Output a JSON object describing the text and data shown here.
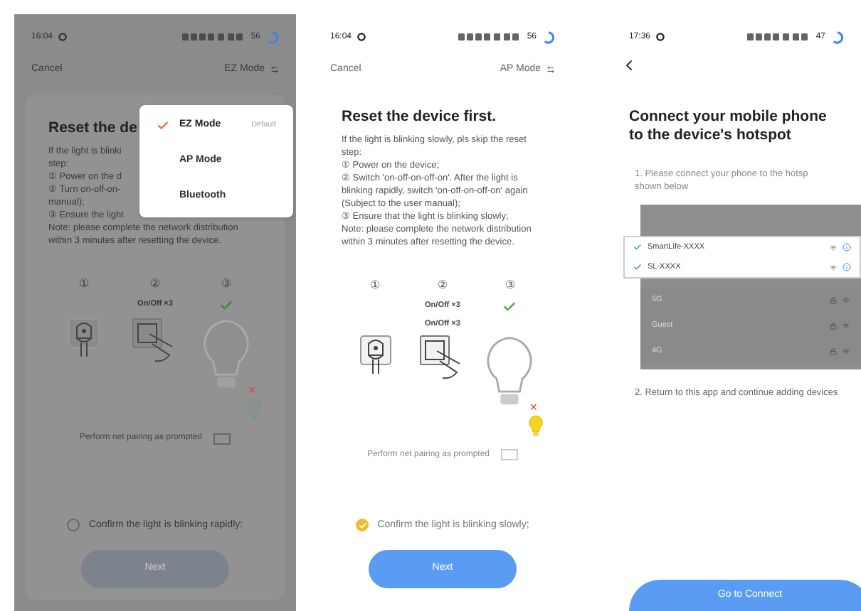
{
  "screens": [
    {
      "kind": "reset",
      "dimmed": true,
      "status": {
        "time": "16:04",
        "battery": "56"
      },
      "cancel": "Cancel",
      "mode": "EZ Mode",
      "title": "Reset the de",
      "lines": [
        "If the light is blinki",
        "step:",
        "① Power on the d",
        "② Turn on-off-on-",
        "manual);",
        "③ Ensure the light",
        "Note: please complete the network distribution within 3 minutes after resetting the device."
      ],
      "steps": [
        "①",
        "②",
        "③"
      ],
      "switch_labels": [
        "On/Off ×3"
      ],
      "error_mark": "✕",
      "small_bulb_lit": false,
      "pairing": "Perform net pairing as prompted",
      "confirm": {
        "label": "Confirm the light is blinking rapidly:",
        "checked": false
      },
      "next": {
        "label": "Next",
        "disabled": true
      },
      "menu": [
        {
          "label": "EZ Mode",
          "selected": true,
          "badge": "Default"
        },
        {
          "label": "AP Mode",
          "selected": false
        },
        {
          "label": "Bluetooth",
          "selected": false
        }
      ]
    },
    {
      "kind": "reset",
      "dimmed": false,
      "status": {
        "time": "16:04",
        "battery": "56"
      },
      "cancel": "Cancel",
      "mode": "AP Mode",
      "title": "Reset the device first.",
      "lines": [
        "If the light is blinking slowly, pls skip the reset step:",
        "① Power on the device;",
        "② Switch 'on-off-on-off-on'. After the light is blinking rapidly, switch 'on-off-on-off-on' again (Subject to the user manual);",
        "③ Ensure that the light is blinking slowly;",
        "Note: please complete the network distribution within 3 minutes after resetting the device."
      ],
      "steps": [
        "①",
        "②",
        "③"
      ],
      "switch_labels": [
        "On/Off ×3",
        "On/Off ×3"
      ],
      "error_mark": "✕",
      "small_bulb_lit": true,
      "pairing": "Perform net pairing as prompted",
      "confirm": {
        "label": "Confirm the light is blinking slowly;",
        "checked": true
      },
      "next": {
        "label": "Next",
        "disabled": false
      }
    },
    {
      "kind": "hotspot",
      "status": {
        "time": "17:36",
        "battery": "47"
      },
      "title": "Connect your mobile phone to the device's hotspot",
      "step1": "1. Please connect your phone to the hotsp",
      "step1_more": "shown below",
      "networks": [
        {
          "name": "SmartLife-XXXX",
          "highlighted": true
        },
        {
          "name": "SL-XXXX",
          "highlighted": true
        },
        {
          "name": "5G",
          "highlighted": false
        },
        {
          "name": "Guest",
          "highlighted": false
        },
        {
          "name": "4G",
          "highlighted": false
        }
      ],
      "step2": "2. Return to this app and continue adding devices",
      "button": "Go to Connect"
    }
  ]
}
